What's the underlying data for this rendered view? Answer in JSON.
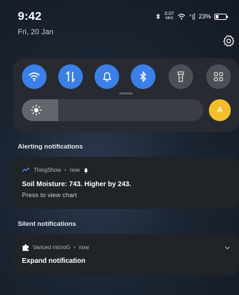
{
  "status_bar": {
    "time": "9:42",
    "network_speed_value": "0.07",
    "network_speed_unit": "KB/S",
    "battery_text": "23%",
    "battery_level": 0.23
  },
  "date": "Fri, 20 Jan",
  "quick_settings": {
    "toggles": [
      {
        "icon": "wifi-icon",
        "state": "on"
      },
      {
        "icon": "mobile-data-icon",
        "state": "on"
      },
      {
        "icon": "bell-icon",
        "state": "on"
      },
      {
        "icon": "bluetooth-icon",
        "state": "on"
      },
      {
        "icon": "flashlight-icon",
        "state": "off"
      },
      {
        "icon": "grid-icon",
        "state": "off"
      }
    ],
    "brightness_level": 0.2,
    "auto_brightness_label": "A",
    "accent_color": "#3b7fe8",
    "auto_color": "#f3be2c"
  },
  "alerting": {
    "header": "Alerting notifications",
    "notification": {
      "app_name": "ThingShow",
      "time": "now",
      "title": "Soil Moisture: 743. Higher by 243.",
      "body": "Press to view chart"
    }
  },
  "silent": {
    "header": "Silent notifications",
    "notification": {
      "app_name": "Vanced microG",
      "time": "now",
      "title": "Expand notification"
    }
  }
}
